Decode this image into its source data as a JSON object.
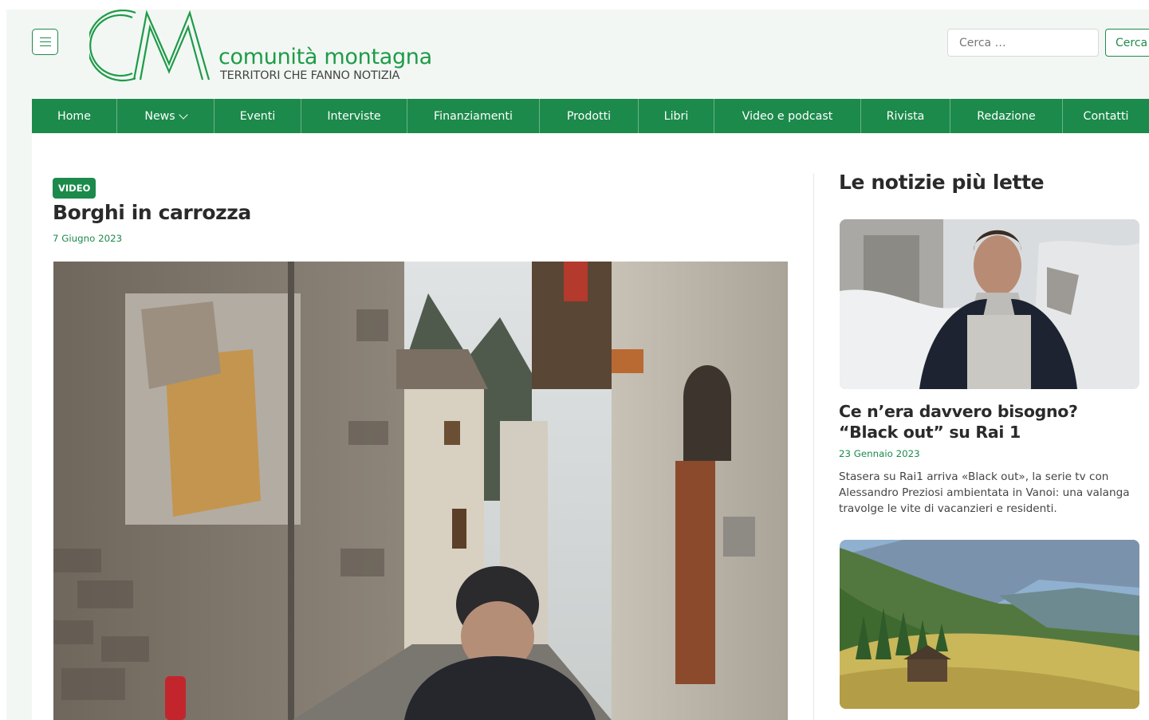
{
  "header": {
    "menu_icon": "hamburger-menu-icon",
    "logo": {
      "monogram": "CM",
      "name": "comunità montagna",
      "tagline": "TERRITORI CHE FANNO NOTIZIA",
      "color": "#1f9b48"
    },
    "search": {
      "placeholder": "Cerca …",
      "button_label": "Cerca"
    }
  },
  "nav": {
    "items": [
      {
        "label": "Home"
      },
      {
        "label": "News",
        "has_dropdown": true
      },
      {
        "label": "Eventi"
      },
      {
        "label": "Interviste"
      },
      {
        "label": "Finanziamenti"
      },
      {
        "label": "Prodotti"
      },
      {
        "label": "Libri"
      },
      {
        "label": "Video e podcast"
      },
      {
        "label": "Rivista"
      },
      {
        "label": "Redazione"
      },
      {
        "label": "Contatti"
      }
    ],
    "background": "#1c8a4b"
  },
  "article": {
    "category": "VIDEO",
    "title": "Borghi in carrozza",
    "date": "7 Giugno 2023",
    "media": "video-frame-alpine-village-street"
  },
  "sidebar": {
    "title": "Le notizie più lette",
    "cards": [
      {
        "image": "man-in-snowy-village-photo",
        "title": "Ce n’era davvero bisogno? “Black out” su Rai 1",
        "date": "23 Gennaio 2023",
        "excerpt": "Stasera su Rai1 arriva «Black out», la serie tv con Alessandro Preziosi ambientata in Vanoi: una valanga travolge le vite di vacanzieri e residenti."
      },
      {
        "image": "mountain-valley-hut-photo"
      }
    ]
  },
  "colors": {
    "brand_green": "#1c8a4b",
    "page_background": "#f2f7f4"
  }
}
